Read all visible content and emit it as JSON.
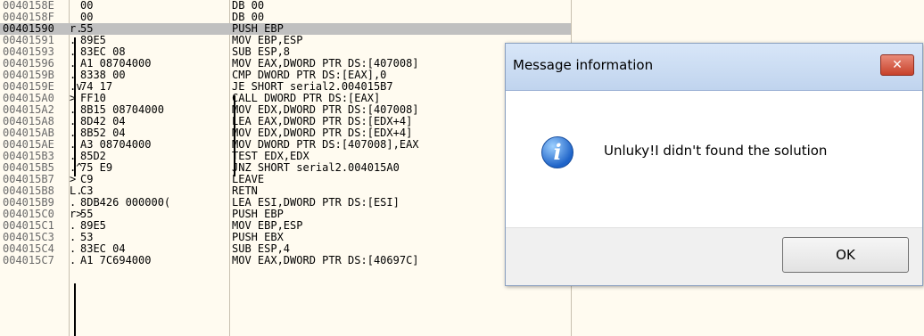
{
  "disassembly": {
    "rows": [
      {
        "addr": "0040158E",
        "mark": "",
        "hex": "00",
        "asm": "DB 00"
      },
      {
        "addr": "0040158F",
        "mark": "",
        "hex": "00",
        "asm": "DB 00"
      },
      {
        "addr": "00401590",
        "mark": "r.",
        "hex": "55",
        "asm": "PUSH EBP"
      },
      {
        "addr": "00401591",
        "mark": ".",
        "hex": "89E5",
        "asm": "MOV EBP,ESP"
      },
      {
        "addr": "00401593",
        "mark": ".",
        "hex": "83EC 08",
        "asm": "SUB ESP,8"
      },
      {
        "addr": "00401596",
        "mark": ".",
        "hex": "A1 08704000",
        "asm": "MOV EAX,DWORD PTR DS:[407008]"
      },
      {
        "addr": "0040159B",
        "mark": ".",
        "hex": "8338 00",
        "asm": "CMP DWORD PTR DS:[EAX],0"
      },
      {
        "addr": "0040159E",
        "mark": ".v",
        "hex": "74 17",
        "asm": "JE SHORT serial2.004015B7"
      },
      {
        "addr": "004015A0",
        "mark": ">",
        "hex": "FF10",
        "asm": "CALL DWORD PTR DS:[EAX]"
      },
      {
        "addr": "004015A2",
        "mark": ".",
        "hex": "8B15 08704000",
        "asm": "MOV EDX,DWORD PTR DS:[407008]"
      },
      {
        "addr": "004015A8",
        "mark": ".",
        "hex": "8D42 04",
        "asm": "LEA EAX,DWORD PTR DS:[EDX+4]"
      },
      {
        "addr": "004015AB",
        "mark": ".",
        "hex": "8B52 04",
        "asm": "MOV EDX,DWORD PTR DS:[EDX+4]"
      },
      {
        "addr": "004015AE",
        "mark": ".",
        "hex": "A3 08704000",
        "asm": "MOV DWORD PTR DS:[407008],EAX"
      },
      {
        "addr": "004015B3",
        "mark": ".",
        "hex": "85D2",
        "asm": "TEST EDX,EDX"
      },
      {
        "addr": "004015B5",
        "mark": ".^",
        "hex": "75 E9",
        "asm": "JNZ SHORT serial2.004015A0"
      },
      {
        "addr": "004015B7",
        "mark": ">",
        "hex": "C9",
        "asm": "LEAVE"
      },
      {
        "addr": "004015B8",
        "mark": "L.",
        "hex": "C3",
        "asm": "RETN"
      },
      {
        "addr": "004015B9",
        "mark": ".",
        "hex": "8DB426 000000(",
        "asm": "LEA ESI,DWORD PTR DS:[ESI]"
      },
      {
        "addr": "004015C0",
        "mark": "r>",
        "hex": "55",
        "asm": "PUSH EBP"
      },
      {
        "addr": "004015C1",
        "mark": ".",
        "hex": "89E5",
        "asm": "MOV EBP,ESP"
      },
      {
        "addr": "004015C3",
        "mark": ".",
        "hex": "53",
        "asm": "PUSH EBX"
      },
      {
        "addr": "004015C4",
        "mark": ".",
        "hex": "83EC 04",
        "asm": "SUB ESP,4"
      },
      {
        "addr": "004015C7",
        "mark": ".",
        "hex": "A1 7C694000",
        "asm": "MOV EAX,DWORD PTR DS:[40697C]"
      }
    ]
  },
  "dialog": {
    "title": "Message information",
    "close_label": "✕",
    "icon": "info-icon",
    "icon_glyph": "i",
    "message": "Unluky!I didn't found the solution",
    "ok_label": "OK"
  }
}
